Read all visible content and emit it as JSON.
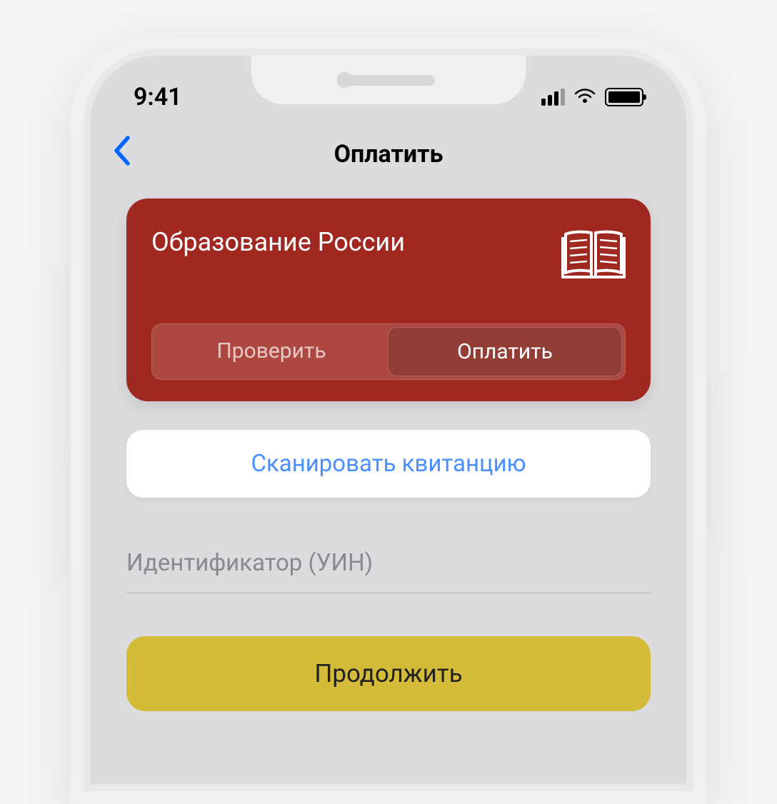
{
  "statusBar": {
    "time": "9:41"
  },
  "navBar": {
    "title": "Оплатить"
  },
  "card": {
    "title": "Образование России",
    "segments": {
      "check": "Проверить",
      "pay": "Оплатить"
    }
  },
  "scanButton": {
    "label": "Сканировать квитанцию"
  },
  "input": {
    "placeholder": "Идентификатор (УИН)"
  },
  "continueButton": {
    "label": "Продолжить"
  },
  "colors": {
    "cardBackground": "#9f2820",
    "link": "#4a8fff",
    "primaryButton": "#d4bb3a",
    "backChevron": "#0066ff"
  }
}
